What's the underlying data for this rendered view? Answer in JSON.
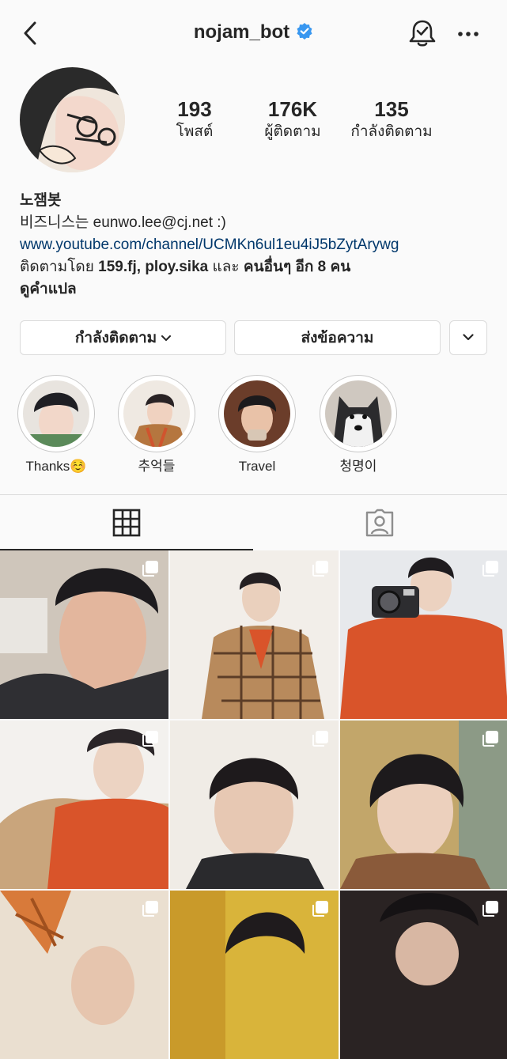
{
  "header": {
    "username": "nojam_bot"
  },
  "profile": {
    "stats": [
      {
        "value": "193",
        "label": "โพสต์"
      },
      {
        "value": "176K",
        "label": "ผู้ติดตาม"
      },
      {
        "value": "135",
        "label": "กำลังติดตาม"
      }
    ],
    "name": "노잼봇",
    "bio_line": "비즈니스는 eunwo.lee@cj.net :)",
    "link": "www.youtube.com/channel/UCMKn6ul1eu4iJ5bZytArywg",
    "followed_by": {
      "prefix": "ติดตามโดย ",
      "accounts": "159.fj, ploy.sika",
      "middle": " และ ",
      "others": "คนอื่นๆ อีก 8 คน"
    },
    "translate": "ดูคำแปล"
  },
  "actions": {
    "following_label": "กำลังติดตาม",
    "message_label": "ส่งข้อความ"
  },
  "highlights": [
    {
      "label": "Thanks☺️"
    },
    {
      "label": "추억들"
    },
    {
      "label": "Travel"
    },
    {
      "label": "청명이"
    }
  ],
  "colors": {
    "accent_blue": "#3897f0",
    "link": "#00376b",
    "sweater_orange": "#d9542a"
  }
}
